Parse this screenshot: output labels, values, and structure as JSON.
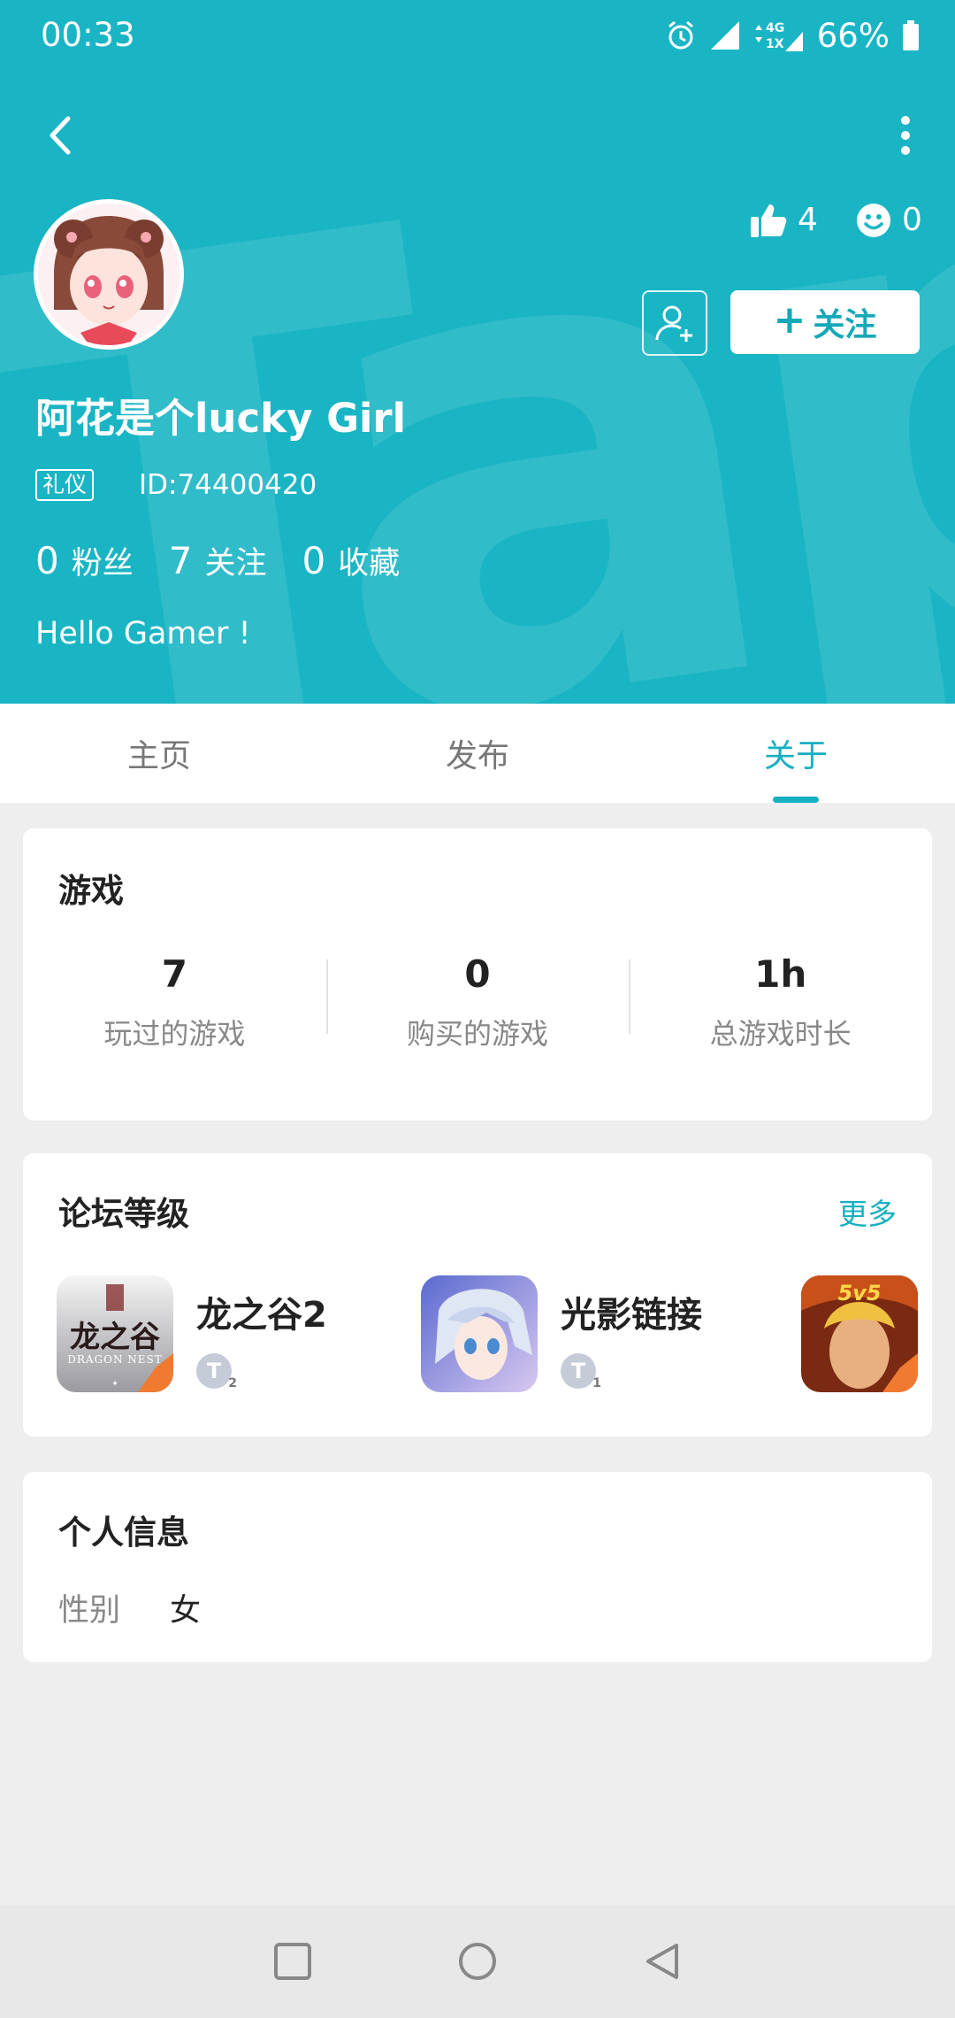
{
  "status_bar": {
    "time": "00:33",
    "network": "4G 1X",
    "battery": "66%"
  },
  "profile": {
    "likes": "4",
    "smiles": "0",
    "follow_label": "关注",
    "username": "阿花是个lucky Girl",
    "badge": "礼仪",
    "user_id": "ID:74400420",
    "counts": [
      {
        "num": "0",
        "label": "粉丝"
      },
      {
        "num": "7",
        "label": "关注"
      },
      {
        "num": "0",
        "label": "收藏"
      }
    ],
    "bio": "Hello Gamer !"
  },
  "tabs": [
    {
      "label": "主页",
      "active": false
    },
    {
      "label": "发布",
      "active": false
    },
    {
      "label": "关于",
      "active": true
    }
  ],
  "games": {
    "title": "游戏",
    "stats": [
      {
        "value": "7",
        "label": "玩过的游戏"
      },
      {
        "value": "0",
        "label": "购买的游戏"
      },
      {
        "value": "1h",
        "label": "总游戏时长"
      }
    ]
  },
  "forum": {
    "title": "论坛等级",
    "more": "更多",
    "items": [
      {
        "name": "龙之谷2",
        "icon_text": "龙之谷",
        "icon_sub": "DRAGON NEST",
        "level": "2"
      },
      {
        "name": "光影链接",
        "level": "1"
      },
      {
        "name": "",
        "icon_text": "5v5"
      }
    ]
  },
  "personal_info": {
    "title": "个人信息",
    "gender_key": "性别",
    "gender_value": "女"
  },
  "colors": {
    "primary": "#1ab5c4",
    "accent": "#17b0c0"
  }
}
